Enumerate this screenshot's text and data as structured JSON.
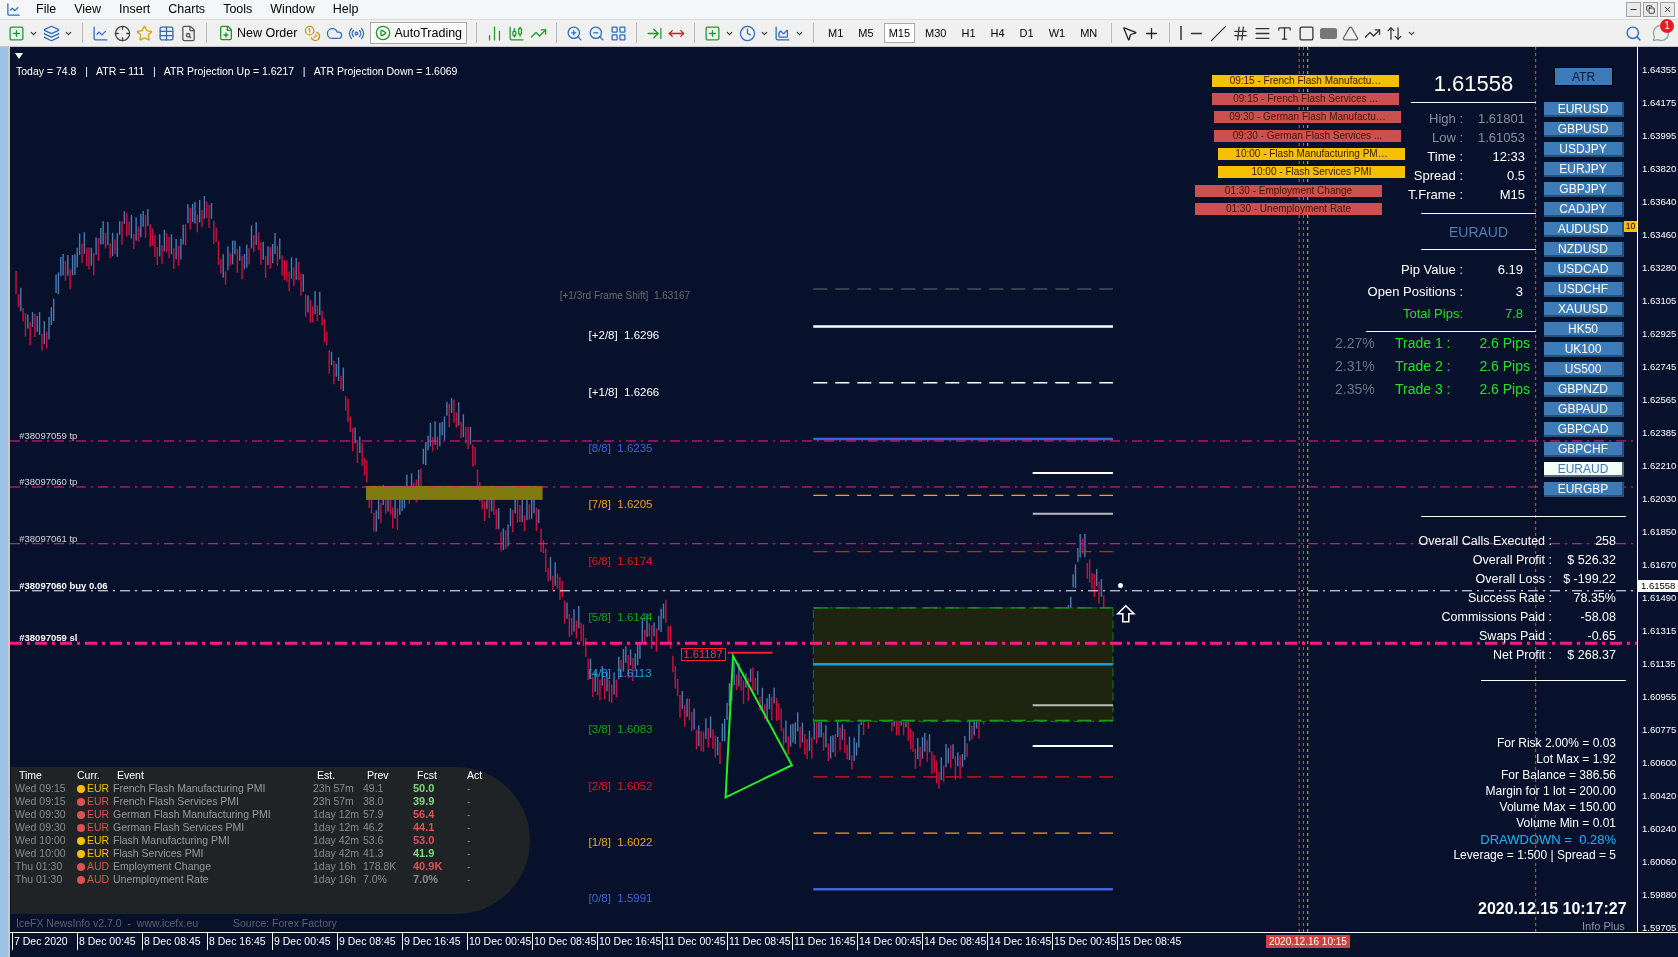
{
  "menu": [
    "File",
    "View",
    "Insert",
    "Charts",
    "Tools",
    "Window",
    "Help"
  ],
  "toolbar": {
    "new_order": "New Order",
    "auto_trading": "AutoTrading",
    "notifications": "1",
    "timeframes": [
      {
        "label": "M1",
        "selected": false
      },
      {
        "label": "M5",
        "selected": false
      },
      {
        "label": "M15",
        "selected": true
      },
      {
        "label": "M30",
        "selected": false
      },
      {
        "label": "H1",
        "selected": false
      },
      {
        "label": "H4",
        "selected": false
      },
      {
        "label": "D1",
        "selected": false
      },
      {
        "label": "W1",
        "selected": false
      },
      {
        "label": "MN",
        "selected": false
      }
    ]
  },
  "chart": {
    "atr_info": "Today = 74.8   |   ATR = 111   |   ATR Projection Up = 1.6217   |   ATR Projection Down = 1.6069",
    "frame_shift": "[+1/3rd Frame Shift]  1.63167",
    "levels": [
      {
        "text": "[+2/8]  1.6296",
        "color": "#ffffff",
        "kind": "solid"
      },
      {
        "text": "[+1/8]  1.6266",
        "color": "#ffffff",
        "kind": "dashed"
      },
      {
        "text": "[8/8]  1.6235",
        "color": "#3f63d6",
        "kind": "solid"
      },
      {
        "text": "[7/8]  1.6205",
        "color": "#f0a020",
        "kind": "dashed"
      },
      {
        "text": "[6/8]  1.6174",
        "color": "#e01818",
        "kind": "dashed"
      },
      {
        "text": "[5/8]  1.6144",
        "color": "#14a014",
        "kind": "dashed"
      },
      {
        "text": "[4/8]  1.6113",
        "color": "#1aa0e8",
        "kind": "solid"
      },
      {
        "text": "[3/8]  1.6083",
        "color": "#14a014",
        "kind": "dashed"
      },
      {
        "text": "[2/8]  1.6052",
        "color": "#e01818",
        "kind": "dashed"
      },
      {
        "text": "[1/8]  1.6022",
        "color": "#f0a020",
        "kind": "dashed"
      },
      {
        "text": "[0/8]  1.5991",
        "color": "#3f63d6",
        "kind": "solid"
      }
    ],
    "order_lines": [
      {
        "label": "#38097059 tp",
        "kind": "tp"
      },
      {
        "label": "#38097060 tp",
        "kind": "tp"
      },
      {
        "label": "#38097061 tp",
        "kind": "tp"
      },
      {
        "label": "#38097060 buy 0.06",
        "kind": "buy"
      },
      {
        "label": "#38097059 sl",
        "kind": "sl"
      }
    ],
    "pivot_label": "1.61187",
    "news_bars": [
      {
        "text": "09:15 - French Flash Manufactu…",
        "color": "#f5c000"
      },
      {
        "text": "09:15 - French Flash Services ...",
        "color": "#cd5050"
      },
      {
        "text": "09:30 - German Flash Manufactu…",
        "color": "#cd5050"
      },
      {
        "text": "09:30 - German Flash Services ...",
        "color": "#cd5050"
      },
      {
        "text": "10:00 - Flash Manufacturing PM…",
        "color": "#f5c000"
      },
      {
        "text": "10:00 - Flash Services PMI",
        "color": "#f5c000"
      },
      {
        "text": "01:30 - Employment Change",
        "color": "#cd5050"
      },
      {
        "text": "01:30 - Unemployment Rate",
        "color": "#cd5050"
      }
    ],
    "price": "1.61558",
    "quote_rows": [
      {
        "label": "High :",
        "value": "1.61801",
        "kind": "muted"
      },
      {
        "label": "Low :",
        "value": "1.61053",
        "kind": "muted"
      },
      {
        "label": "Time :",
        "value": "12:33",
        "kind": "plain"
      },
      {
        "label": "Spread :",
        "value": "0.5",
        "kind": "plain"
      },
      {
        "label": "T.Frame :",
        "value": "M15",
        "kind": "plain"
      }
    ],
    "symbol": "EURAUD",
    "account_rows": [
      {
        "label": "Pip Value :",
        "value": "6.19",
        "kind": "plain"
      },
      {
        "label": "Open Positions :",
        "value": "3",
        "kind": "plain"
      },
      {
        "label": "Total Pips:",
        "value": "7.8",
        "kind": "accent"
      }
    ],
    "trades": [
      {
        "percent": "2.27%",
        "label": "Trade 1 :",
        "value": "2.6 Pips"
      },
      {
        "percent": "2.31%",
        "label": "Trade 2 :",
        "value": "2.6 Pips"
      },
      {
        "percent": "2.35%",
        "label": "Trade 3 :",
        "value": "2.6 Pips"
      }
    ],
    "atr_button": "ATR",
    "symbols": [
      {
        "label": "EURUSD",
        "selected": false
      },
      {
        "label": "GBPUSD",
        "selected": false
      },
      {
        "label": "USDJPY",
        "selected": false
      },
      {
        "label": "EURJPY",
        "selected": false
      },
      {
        "label": "GBPJPY",
        "selected": false
      },
      {
        "label": "CADJPY",
        "selected": false
      },
      {
        "label": "AUDUSD",
        "selected": false
      },
      {
        "label": "NZDUSD",
        "selected": false
      },
      {
        "label": "USDCAD",
        "selected": false
      },
      {
        "label": "USDCHF",
        "selected": false
      },
      {
        "label": "XAUUSD",
        "selected": false
      },
      {
        "label": "HK50",
        "selected": false
      },
      {
        "label": "UK100",
        "selected": false
      },
      {
        "label": "US500",
        "selected": false
      },
      {
        "label": "GBPNZD",
        "selected": false
      },
      {
        "label": "GBPAUD",
        "selected": false
      },
      {
        "label": "GBPCAD",
        "selected": false
      },
      {
        "label": "GBPCHF",
        "selected": false
      },
      {
        "label": "EURAUD",
        "selected": true
      },
      {
        "label": "EURGBP",
        "selected": false
      }
    ],
    "side_tag": "10",
    "stats": [
      {
        "label": "Overall Calls Executed :",
        "value": "258"
      },
      {
        "label": "Overall Profit :",
        "value": "$ 526.32"
      },
      {
        "label": "Overall Loss :",
        "value": "$ -199.22"
      },
      {
        "label": "Success Rate :",
        "value": "78.35%"
      },
      {
        "label": "Commissions Paid :",
        "value": "-58.08"
      },
      {
        "label": "Swaps Paid :",
        "value": "-0.65"
      },
      {
        "label": "Net Profit :",
        "value": "$ 268.37"
      }
    ],
    "lot_info": [
      {
        "text": "For Risk 2.00% = 0.03",
        "kind": "plain"
      },
      {
        "text": "Lot Max = 1.92",
        "kind": "plain"
      },
      {
        "text": "For Balance = 386.56",
        "kind": "plain"
      },
      {
        "text": "Margin for 1 lot = 200.00",
        "kind": "plain"
      },
      {
        "text": "Volume Max = 150.00",
        "kind": "plain"
      },
      {
        "text": "Volume Min = 0.01",
        "kind": "plain"
      },
      {
        "text": "DRAWDOWN =  0.28%",
        "kind": "highlight"
      },
      {
        "text": "Leverage = 1:500 | Spread = 5",
        "kind": "plain"
      }
    ],
    "clock": "2020.12.15 10:17:27",
    "info_plus": "Info Plus"
  },
  "news": {
    "columns": [
      "Time",
      "Curr.",
      "Event",
      "Est.",
      "Prev",
      "Fcst",
      "Act"
    ],
    "rows": [
      {
        "time": "Wed 09:15",
        "currency": "EUR",
        "color": "#f5c000",
        "event": "French Flash Manufacturing PMI",
        "est": "23h 57m",
        "prev": "49.1",
        "forecast": {
          "text": "50.0",
          "color": "#7ed87e"
        },
        "act": "-"
      },
      {
        "time": "Wed 09:15",
        "currency": "EUR",
        "color": "#d9534f",
        "event": "French Flash Services PMI",
        "est": "23h 57m",
        "prev": "38.0",
        "forecast": {
          "text": "39.9",
          "color": "#7ed87e"
        },
        "act": "-"
      },
      {
        "time": "Wed 09:30",
        "currency": "EUR",
        "color": "#d9534f",
        "event": "German Flash Manufacturing PMI",
        "est": "1day 12m",
        "prev": "57.9",
        "forecast": {
          "text": "56.4",
          "color": "#d9534f"
        },
        "act": "-"
      },
      {
        "time": "Wed 09:30",
        "currency": "EUR",
        "color": "#d9534f",
        "event": "German Flash Services PMI",
        "est": "1day 12m",
        "prev": "46.2",
        "forecast": {
          "text": "44.1",
          "color": "#d9534f"
        },
        "act": "-"
      },
      {
        "time": "Wed 10:00",
        "currency": "EUR",
        "color": "#f5c000",
        "event": "Flash Manufacturing PMI",
        "est": "1day 42m",
        "prev": "53.6",
        "forecast": {
          "text": "53.0",
          "color": "#d9534f"
        },
        "act": "-"
      },
      {
        "time": "Wed 10:00",
        "currency": "EUR",
        "color": "#f5c000",
        "event": "Flash Services PMI",
        "est": "1day 42m",
        "prev": "41.3",
        "forecast": {
          "text": "41.9",
          "color": "#7ed87e"
        },
        "act": "-"
      },
      {
        "time": "Thu 01:30",
        "currency": "AUD",
        "color": "#d9534f",
        "event": "Employment Change",
        "est": "1day 16h",
        "prev": "178.8K",
        "forecast": {
          "text": "40.9K",
          "color": "#d9534f"
        },
        "act": "-"
      },
      {
        "time": "Thu 01:30",
        "currency": "AUD",
        "color": "#d9534f",
        "event": "Unemployment Rate",
        "est": "1day 16h",
        "prev": "7.0%",
        "forecast": {
          "text": "7.0%",
          "color": "#8a8a8a"
        },
        "act": "-"
      }
    ],
    "footer": "IceFX NewsInfo v2.7.0  -  www.icefx.eu",
    "source": "Source: Forex Factory"
  },
  "price_axis": [
    "1.64355",
    "1.64175",
    "1.63995",
    "1.63820",
    "1.63640",
    "1.63460",
    "1.63280",
    "1.63105",
    "1.62925",
    "1.62745",
    "1.62565",
    "1.62385",
    "1.62210",
    "1.62030",
    "1.61850",
    "1.61670",
    "1.61490",
    "1.61315",
    "1.61135",
    "1.60955",
    "1.60775",
    "1.60600",
    "1.60420",
    "1.60240",
    "1.60060",
    "1.59880",
    "1.59705"
  ],
  "current_price": "1.61558",
  "time_axis": [
    "7 Dec 2020",
    "8 Dec 00:45",
    "8 Dec 08:45",
    "8 Dec 16:45",
    "9 Dec 00:45",
    "9 Dec 08:45",
    "9 Dec 16:45",
    "10 Dec 00:45",
    "10 Dec 08:45",
    "10 Dec 16:45",
    "11 Dec 00:45",
    "11 Dec 08:45",
    "11 Dec 16:45",
    "14 Dec 00:45",
    "14 Dec 08:45",
    "14 Dec 16:45",
    "15 Dec 00:45",
    "15 Dec 08:45"
  ],
  "time_marker": "2020.12.16 10:15"
}
